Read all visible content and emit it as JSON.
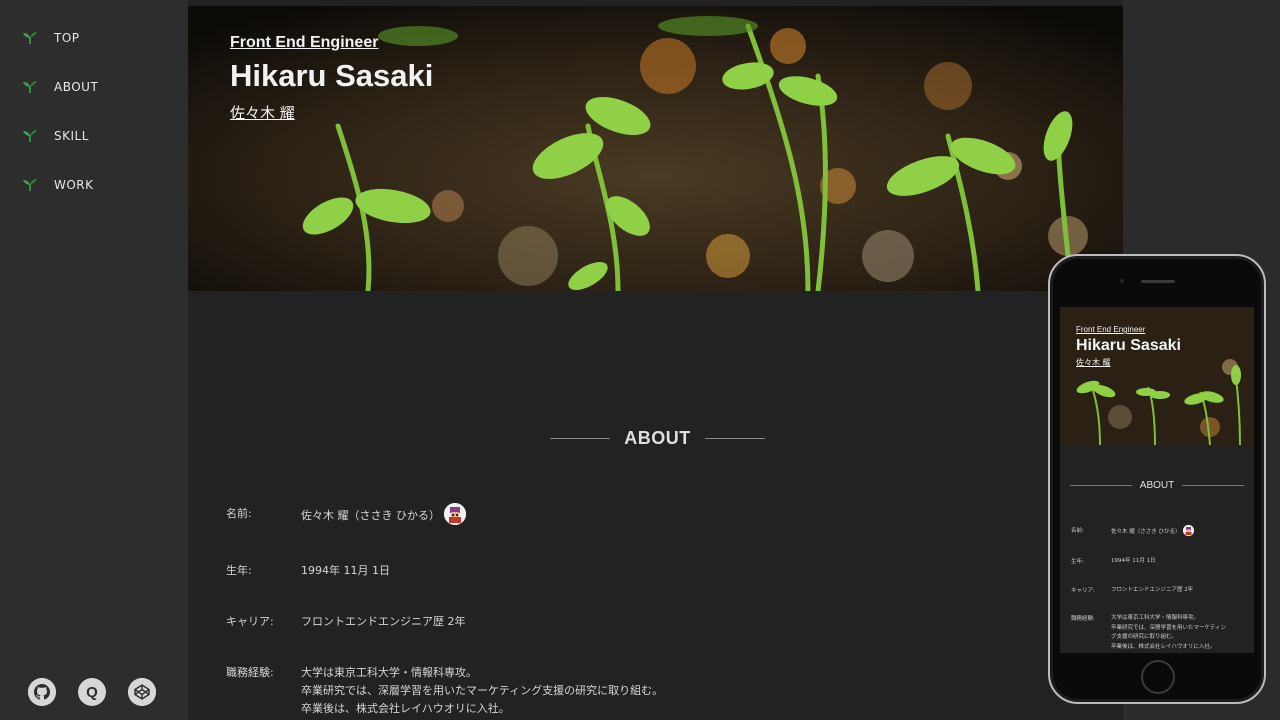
{
  "sidebar": {
    "items": [
      {
        "label": "TOP",
        "icon": "sprout-icon"
      },
      {
        "label": "ABOUT",
        "icon": "sprout-icon"
      },
      {
        "label": "SKILL",
        "icon": "sprout-icon"
      },
      {
        "label": "WORK",
        "icon": "sprout-icon"
      }
    ],
    "social": [
      {
        "icon": "github-icon",
        "glyph": ""
      },
      {
        "icon": "qiita-icon",
        "glyph": "Q"
      },
      {
        "icon": "codepen-icon",
        "glyph": ""
      }
    ]
  },
  "hero": {
    "subtitle": "Front End Engineer",
    "name": "Hikaru Sasaki",
    "name_kana": "佐々木 耀"
  },
  "about": {
    "title": "ABOUT",
    "rows": [
      {
        "label": "名前:",
        "value": "佐々木 耀（ささき ひかる）"
      },
      {
        "label": "生年:",
        "value": "1994年 11月 1日"
      },
      {
        "label": "キャリア:",
        "value": "フロントエンドエンジニア歴 2年"
      },
      {
        "label": "職務経験:",
        "lines": [
          "大学は東京工科大学・情報科専攻。",
          "卒業研究では、深層学習を用いたマーケティング支援の研究に取り組む。",
          "卒業後は、株式会社レイハウオリに入社。"
        ]
      }
    ]
  },
  "mobile": {
    "subtitle": "Front End Engineer",
    "name": "Hikaru Sasaki",
    "name_kana": "佐々木 耀",
    "about_title": "ABOUT",
    "rows": [
      {
        "label": "名前:",
        "value": "佐々木 耀（ささき ひかる）"
      },
      {
        "label": "生年:",
        "value": "1994年 11月 1日"
      },
      {
        "label": "キャリア:",
        "value": "フロントエンドエンジニア歴 2年"
      },
      {
        "label": "職務経験:",
        "lines": [
          "大学は東京工科大学・情報科専攻。",
          "卒業研究では、深層学習を用いたマーケティン",
          "グ支援の研究に取り組む。",
          "卒業後は、株式会社レイハウオリに入社。"
        ]
      }
    ]
  },
  "colors": {
    "accent": "#3fa34d",
    "sidebar_bg": "#2d2d2d",
    "content_bg": "#232222"
  }
}
